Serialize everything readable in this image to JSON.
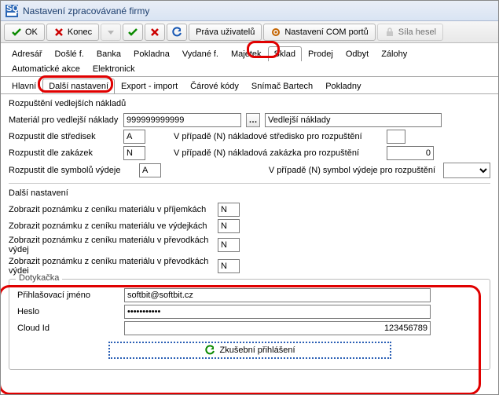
{
  "window": {
    "title": "Nastavení zpracovávané firmy"
  },
  "toolbar": {
    "ok": "OK",
    "end": "Konec",
    "rights": "Práva uživatelů",
    "com": "Nastavení COM portů",
    "pw": "Síla hesel"
  },
  "tabs1": [
    "Adresář",
    "Došlé f.",
    "Banka",
    "Pokladna",
    "Vydané f.",
    "Majetek",
    "Sklad",
    "Prodej",
    "Odbyt",
    "Zálohy",
    "Automatické akce",
    "Elektronick"
  ],
  "tabs2": [
    "Hlavní",
    "Další nastavení",
    "Export - import",
    "Čárové kódy",
    "Snímač Bartech",
    "Pokladny"
  ],
  "groups": {
    "rozp": "Rozpuštění vedlejších nákladů",
    "dalsi": "Další nastavení"
  },
  "rozp": {
    "material_label": "Materiál pro vedlejší náklady",
    "material_value": "999999999999",
    "material_desc": "Vedlejší náklady",
    "stredisek_label": "Rozpustit dle středisek",
    "stredisek_value": "A",
    "stredisko_case": "V případě (N) nákladové středisko pro rozpuštění",
    "zakazek_label": "Rozpustit dle zakázek",
    "zakazek_value": "N",
    "zakazka_case": "V případě (N) nákladová zakázka pro rozpuštění",
    "zakazka_case_value": "0",
    "symbolu_label": "Rozpustit dle symbolů výdeje",
    "symbolu_value": "A",
    "symbol_case": "V případě (N) symbol výdeje pro rozpuštění"
  },
  "dalsi": [
    {
      "label": "Zobrazit poznámku z ceníku materiálu v příjemkách",
      "value": "N"
    },
    {
      "label": "Zobrazit poznámku z ceníku materiálu ve výdejkách",
      "value": "N"
    },
    {
      "label": "Zobrazit poznámku z ceníku materiálu v převodkách výdej",
      "value": "N"
    },
    {
      "label": "Zobrazit poznámku z ceníku materiálu v převodkách výdej",
      "value": "N"
    }
  ],
  "doty": {
    "title": "Dotykačka",
    "login_label": "Přihlašovací jméno",
    "login_value": "softbit@softbit.cz",
    "pw_label": "Heslo",
    "pw_value": "●●●●●●●●●●●",
    "cloud_label": "Cloud Id",
    "cloud_value": "123456789",
    "test_login": "Zkušební přihlášení"
  }
}
